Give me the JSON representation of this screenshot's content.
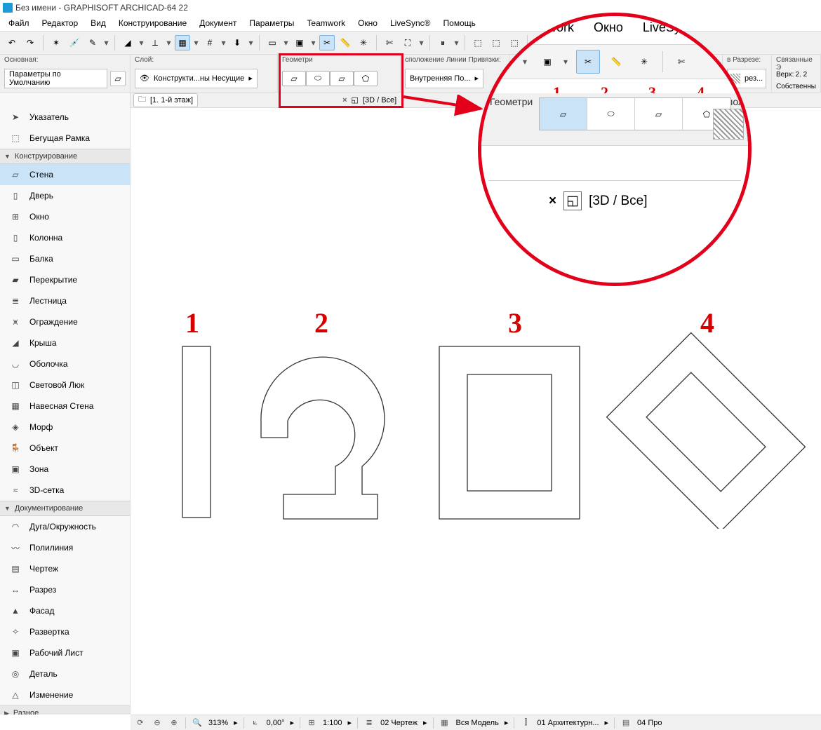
{
  "title": "Без имени - GRAPHISOFT ARCHICAD-64 22",
  "menus": [
    "Файл",
    "Редактор",
    "Вид",
    "Конструирование",
    "Документ",
    "Параметры",
    "Teamwork",
    "Окно",
    "LiveSync®",
    "Помощь"
  ],
  "infobar": {
    "main_label": "Основная:",
    "main_button": "Параметры по Умолчанию",
    "layer_label": "Слой:",
    "layer_value": "Конструкти...ны Несущие",
    "geom_label": "Геометри",
    "refline_label": "сположение Линии Привязки:",
    "refline_value": "Внутренняя По...",
    "section_label": "в Разрезе:",
    "section_btn": "рез...",
    "linked_label": "Связанные Э",
    "top_label": "Верх:",
    "top_value": "2. 2",
    "own": "Собственны"
  },
  "tabs": {
    "floor": "[1. 1-й этаж]",
    "view3d": "[3D / Все]"
  },
  "toolbox": {
    "arrow": "Указатель",
    "marquee": "Бегущая Рамка",
    "sec_design": "Конструирование",
    "wall": "Стена",
    "door": "Дверь",
    "window": "Окно",
    "column": "Колонна",
    "beam": "Балка",
    "slab": "Перекрытие",
    "stair": "Лестница",
    "railing": "Ограждение",
    "roof": "Крыша",
    "shell": "Оболочка",
    "skylight": "Световой Люк",
    "curtain": "Навесная Стена",
    "morph": "Морф",
    "object": "Объект",
    "zone": "Зона",
    "mesh": "3D-сетка",
    "sec_doc": "Документирование",
    "arc": "Дуга/Окружность",
    "polyline": "Полилиния",
    "drawing": "Чертеж",
    "section": "Разрез",
    "elevation": "Фасад",
    "ielevation": "Развертка",
    "worksheet": "Рабочий Лист",
    "detail": "Деталь",
    "change": "Изменение",
    "sec_misc": "Разное"
  },
  "zoom": {
    "menus": [
      "Teamwork",
      "Окно",
      "LiveSync"
    ],
    "geom_label": "Геометри",
    "refline_label": "спол",
    "nums": [
      "1",
      "2",
      "3",
      "4"
    ],
    "tab3d": "[3D / Все]"
  },
  "canvas_nums": [
    "1",
    "2",
    "3",
    "4"
  ],
  "status": {
    "zoom": "313%",
    "angle": "0,00°",
    "scale": "1:100",
    "drawing": "02 Чертеж",
    "model": "Вся Модель",
    "arch": "01 Архитектурн...",
    "pro": "04 Про"
  }
}
